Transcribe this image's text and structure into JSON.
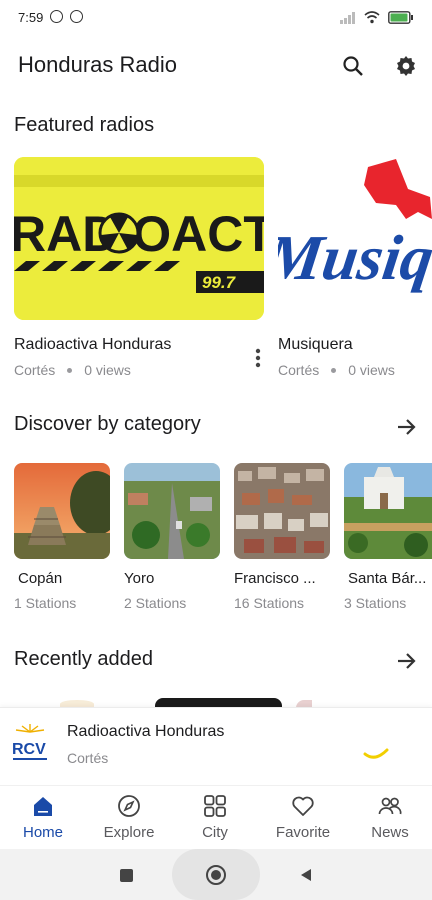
{
  "status_bar": {
    "time": "7:59",
    "battery_color": "#4caf50"
  },
  "app_bar": {
    "title": "Honduras Radio",
    "search_icon": "search-icon",
    "settings_icon": "gear-icon"
  },
  "featured": {
    "title": "Featured radios",
    "items": [
      {
        "name": "Radioactiva Honduras",
        "location": "Cortés",
        "views": "0 views",
        "logo_text": "RADIOACTIVA",
        "freq": "99.7"
      },
      {
        "name": "Musiquera",
        "location": "Cortés",
        "views": "0 views",
        "logo_text": "Musiq"
      }
    ]
  },
  "categories": {
    "title": "Discover by category",
    "items": [
      {
        "name": "Copán",
        "stations": "1 Stations"
      },
      {
        "name": "Yoro",
        "stations": "2 Stations"
      },
      {
        "name": "Francisco ...",
        "stations": "16 Stations"
      },
      {
        "name": "Santa Bár...",
        "stations": "3 Stations"
      }
    ]
  },
  "recent": {
    "title": "Recently added"
  },
  "player": {
    "name": "Radioactiva Honduras",
    "location": "Cortés",
    "logo_text": "RCV"
  },
  "bottom_nav": {
    "active_color": "#1a4aa8",
    "items": [
      {
        "label": "Home",
        "icon": "home-icon"
      },
      {
        "label": "Explore",
        "icon": "compass-icon"
      },
      {
        "label": "City",
        "icon": "grid-icon"
      },
      {
        "label": "Favorite",
        "icon": "heart-icon"
      },
      {
        "label": "News",
        "icon": "people-icon"
      }
    ]
  }
}
